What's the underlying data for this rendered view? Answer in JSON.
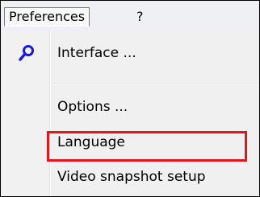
{
  "menubar": {
    "menus": [
      {
        "label": "Preferences",
        "open": true
      },
      {
        "label": "?"
      }
    ]
  },
  "dropdown": {
    "items": [
      {
        "label": "Interface ...",
        "icon": "search-icon"
      },
      {
        "label": "Options ..."
      },
      {
        "label": "Language"
      },
      {
        "label": "Video snapshot setup",
        "highlighted": true
      }
    ]
  },
  "colors": {
    "icon": "#1a1ad6",
    "highlight_border": "#e4161c"
  }
}
